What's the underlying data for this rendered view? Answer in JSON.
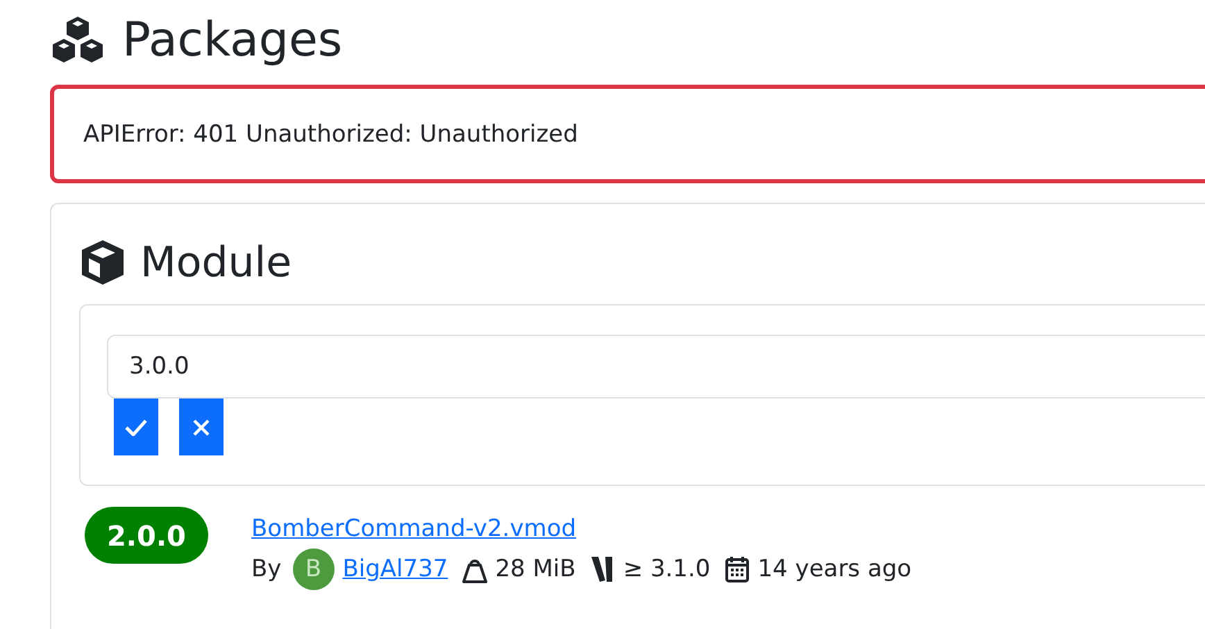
{
  "page_title": "Packages",
  "error": "APIError: 401 Unauthorized: Unauthorized",
  "module": {
    "title": "Module",
    "version_field": {
      "value": "3.0.0"
    },
    "releases": [
      {
        "version": "2.0.0",
        "file": "BomberCommand-v2.vmod",
        "by": "By",
        "avatar_letter": "B",
        "author": "BigAl737",
        "size": "28 MiB",
        "requires": "≥ 3.1.0",
        "age": "14 years ago"
      }
    ]
  }
}
